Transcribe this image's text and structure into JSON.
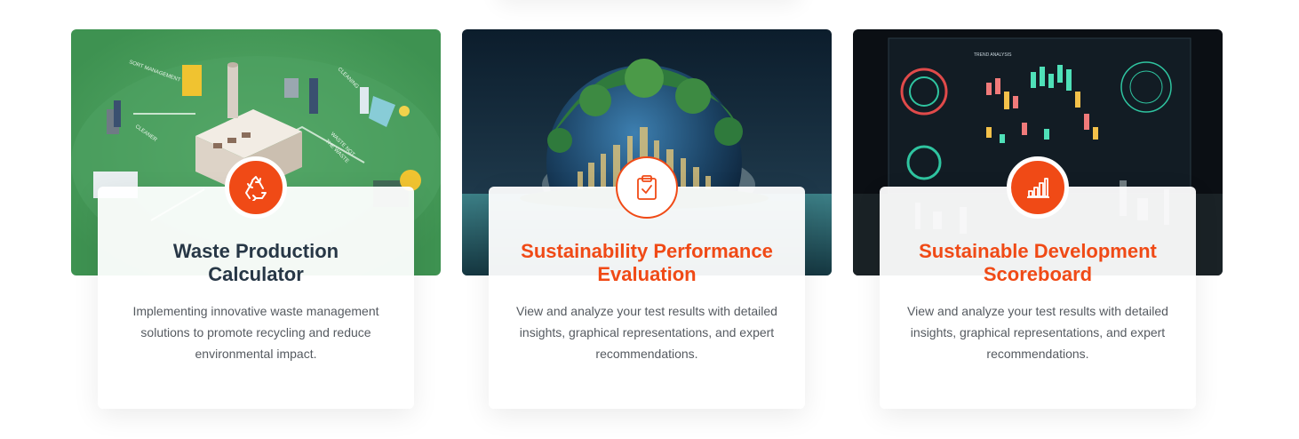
{
  "cards": [
    {
      "title": "Waste Production Calculator",
      "description": "Implementing innovative waste management solutions to promote recycling and reduce environmental impact.",
      "icon": "recycle-icon",
      "image_labels": {
        "sort": "SORT MANAGEMENT",
        "cleaning": "CLEANING",
        "cleaner": "CLEANER",
        "waste1": "WASTE NOT",
        "waste2": "THE WASTE"
      },
      "colors": {
        "title": "#273746",
        "badge": "#f04a16"
      }
    },
    {
      "title": "Sustainability Performance Evaluation",
      "description": "View and analyze your test results with detailed insights, graphical representations, and expert recommendations.",
      "icon": "clipboard-check-icon",
      "colors": {
        "title": "#f04a16",
        "badge": "#ffffff"
      }
    },
    {
      "title": "Sustainable Development Scoreboard",
      "description": "View and analyze your test results with detailed insights, graphical representations, and expert recommendations.",
      "icon": "bar-chart-icon",
      "image_labels": {
        "chart_heading": "TREND ANALYSIS"
      },
      "colors": {
        "title": "#f04a16",
        "badge": "#f04a16"
      }
    }
  ]
}
